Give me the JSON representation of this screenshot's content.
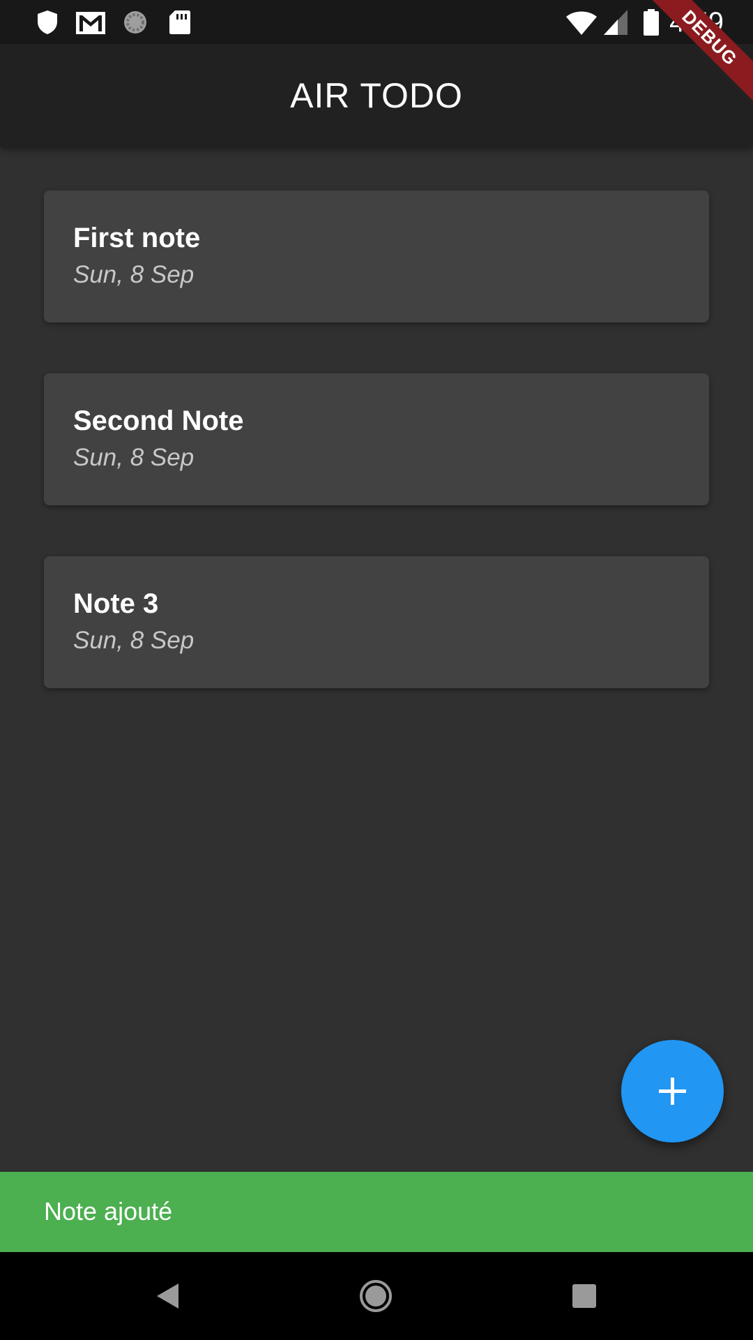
{
  "status_bar": {
    "time": "4:59",
    "icons": [
      "shield-icon",
      "gmail-icon",
      "loading-icon",
      "sd-card-icon",
      "wifi-icon",
      "cell-signal-icon",
      "battery-icon"
    ]
  },
  "debug_banner": {
    "label": "DEBUG"
  },
  "app_bar": {
    "title": "AIR TODO"
  },
  "notes": [
    {
      "title": "First note",
      "date": "Sun, 8 Sep"
    },
    {
      "title": "Second Note",
      "date": "Sun, 8 Sep"
    },
    {
      "title": "Note 3",
      "date": "Sun, 8 Sep"
    }
  ],
  "fab": {
    "icon": "plus-icon"
  },
  "snackbar": {
    "message": "Note ajouté"
  },
  "nav_bar": {
    "buttons": [
      "back-icon",
      "home-icon",
      "recents-icon"
    ]
  },
  "colors": {
    "background": "#303030",
    "app_bar": "#212121",
    "card": "#424242",
    "fab": "#2196f3",
    "snackbar": "#4caf50",
    "debug_ribbon": "#8b1b1f"
  }
}
